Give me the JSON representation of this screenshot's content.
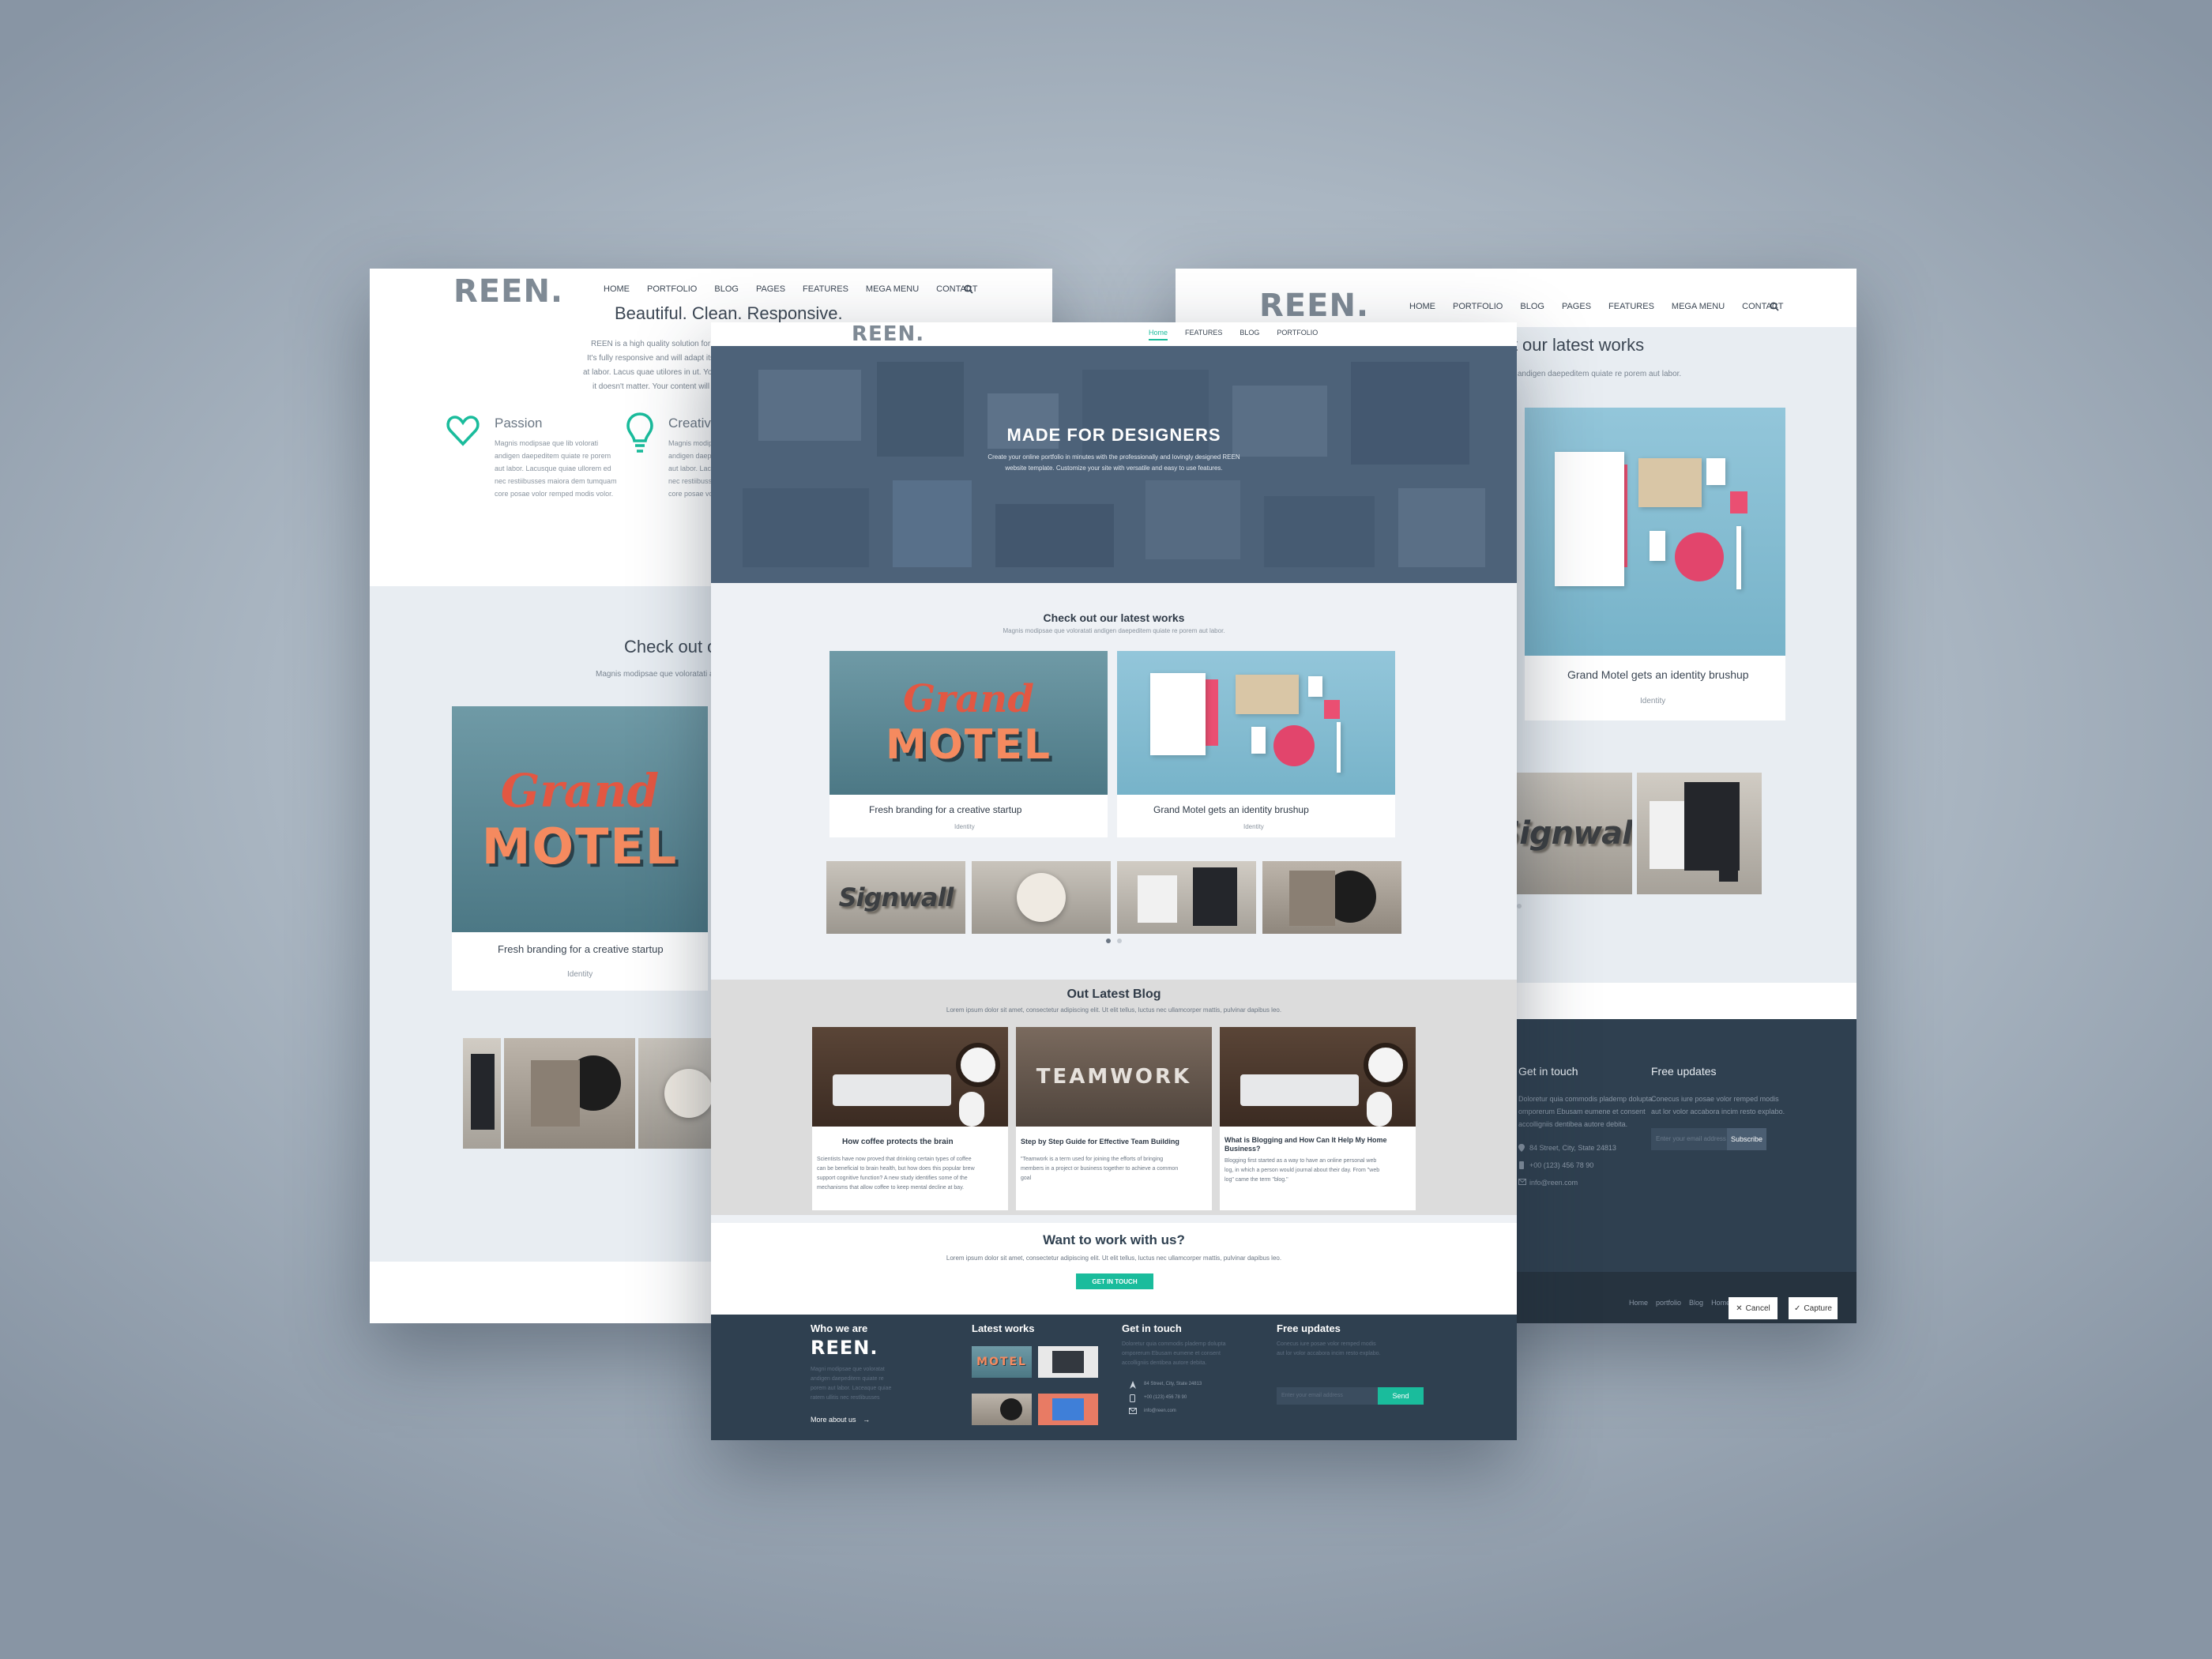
{
  "brand": {
    "logo": "REEN."
  },
  "nav_main": [
    "HOME",
    "PORTFOLIO",
    "BLOG",
    "PAGES",
    "FEATURES",
    "MEGA MENU",
    "CONTACT"
  ],
  "nav_center": [
    "Home",
    "FEATURES",
    "BLOG",
    "PORTFOLIO"
  ],
  "left": {
    "headline": "Beautiful. Clean. Responsive.",
    "intro": [
      "REEN is a high quality solution for those who want a beautiful",
      "It's fully responsive and will adapt itself to any mobile device",
      "at labor. Lacus quae utilores in ut. Your content will always look its",
      "it doesn't matter. Your content will always looks it"
    ],
    "features": [
      {
        "icon": "heart-icon",
        "title": "Passion",
        "lines": [
          "Magnis modipsae que lib volorati",
          "andigen daepeditem quiate re porem",
          "aut labor. Lacusque quiae ullorem ed",
          "nec restiibusses maiora dem tumquam",
          "core posae volor remped modis volor."
        ]
      },
      {
        "icon": "lightbulb-icon",
        "title": "Creativity",
        "lines": [
          "Magnis modipsae que lib volorati",
          "andigen daepeditem quiate re porem",
          "aut labor. Lacusque quiae ullorem",
          "nec restiibusses maiora dem",
          "core posae volor remped modis"
        ]
      }
    ],
    "works_title": "Check out our lates",
    "works_sub": "Magnis modipsae que voloratati andigen daepedite",
    "card": {
      "title": "Fresh branding for a creative startup",
      "tag": "Identity"
    }
  },
  "right": {
    "works_title": "eck out our latest works",
    "works_sub": "que voloratati andigen daepeditem quiate re porem aut labor.",
    "card": {
      "title": "Grand Motel gets an identity brushup",
      "tag": "Identity"
    },
    "get_in_touch": "Get in touch",
    "touch_lines": [
      "Doloretur quia commodis plademp dolupta",
      "omporerum Ebusam eumene et consent",
      "accolligniis dentibea autore debita."
    ],
    "address": "84 Street, City, State 24813",
    "phone": "+00 (123) 456 78 90",
    "email": "info@reen.com",
    "free_updates": "Free updates",
    "updates_lines": [
      "Conecus iure posae volor remped modis",
      "aut lor volor accabora incim resto explabo."
    ],
    "email_placeholder": "Enter your email address",
    "subscribe": "Subscribe",
    "bottom_links": [
      "Home",
      "portfolio",
      "Blog",
      "Home"
    ],
    "cancel": "Cancel",
    "capture": "Capture"
  },
  "center": {
    "hero_title": "MADE FOR DESIGNERS",
    "hero_sub": [
      "Create your online portfolio in minutes with the professionally and lovingly designed REEN",
      "website template. Customize your site with versatile and easy to use features."
    ],
    "works_title": "Check out our latest works",
    "works_sub": "Magnis modipsae que voloratati andigen daepeditem quiate re porem aut labor.",
    "cards": [
      {
        "title": "Fresh branding for a creative startup",
        "tag": "Identity"
      },
      {
        "title": "Grand Motel gets an identity brushup",
        "tag": "Identity"
      }
    ],
    "blog_title": "Out Latest Blog",
    "blog_sub": "Lorem ipsum dolor sit amet, consectetur adipiscing elit. Ut elit tellus, luctus nec ullamcorper mattis, pulvinar dapibus leo.",
    "posts": [
      {
        "title": "How coffee protects the brain",
        "excerpt": [
          "Scientists have now proved that drinking certain types of coffee",
          "can be beneficial to brain health, but how does this popular brew",
          "support cognitive function? A new study identifies some of the",
          "mechanisms that allow coffee to keep mental decline at bay."
        ]
      },
      {
        "title": "Step by Step Guide for Effective Team Building",
        "excerpt": [
          "\"Teamwork is a term used for joining the efforts of bringing",
          "members in a project or business together to achieve a common",
          "goal"
        ]
      },
      {
        "title": "What is Blogging and How Can It Help My Home Business?",
        "excerpt": [
          "Blogging first started as a way to have an online personal web",
          "log, in which a person would journal about their day. From \"web",
          "log\" came the term \"blog.\""
        ]
      }
    ],
    "cta_title": "Want to work with us?",
    "cta_sub": "Lorem ipsum dolor sit amet, consectetur adipiscing elit. Ut elit tellus, luctus nec ullamcorper mattis, pulvinar dapibus leo.",
    "cta_button": "GET IN TOUCH",
    "footer": {
      "who": "Who we are",
      "who_lines": [
        "Magni modipsae que voloratat",
        "andigen daepeditem quiate re",
        "porem aut labor. Laceaque quiae",
        "ratem ullitis nec restlibusses"
      ],
      "more": "More about us",
      "latest": "Latest works",
      "touch": "Get in touch",
      "touch_lines": [
        "Doloretur quia commodis plademp dolupta",
        "omporerum Ebusam eumene et consent",
        "accolligniis dentibea autore debita."
      ],
      "address": "84 Street, City, State 24813",
      "phone": "+00 (123) 456 78 90",
      "email": "info@reen.com",
      "updates": "Free updates",
      "updates_lines": [
        "Conecus iure posae volor remped modis",
        "aut lor volor accabora incim resto explabo."
      ],
      "email_placeholder": "Enter your email address",
      "send": "Send"
    }
  },
  "colors": {
    "accent": "#1abc9c",
    "dark": "#2f4050",
    "hero": "#4d6279",
    "muted": "#e3e7ec"
  }
}
